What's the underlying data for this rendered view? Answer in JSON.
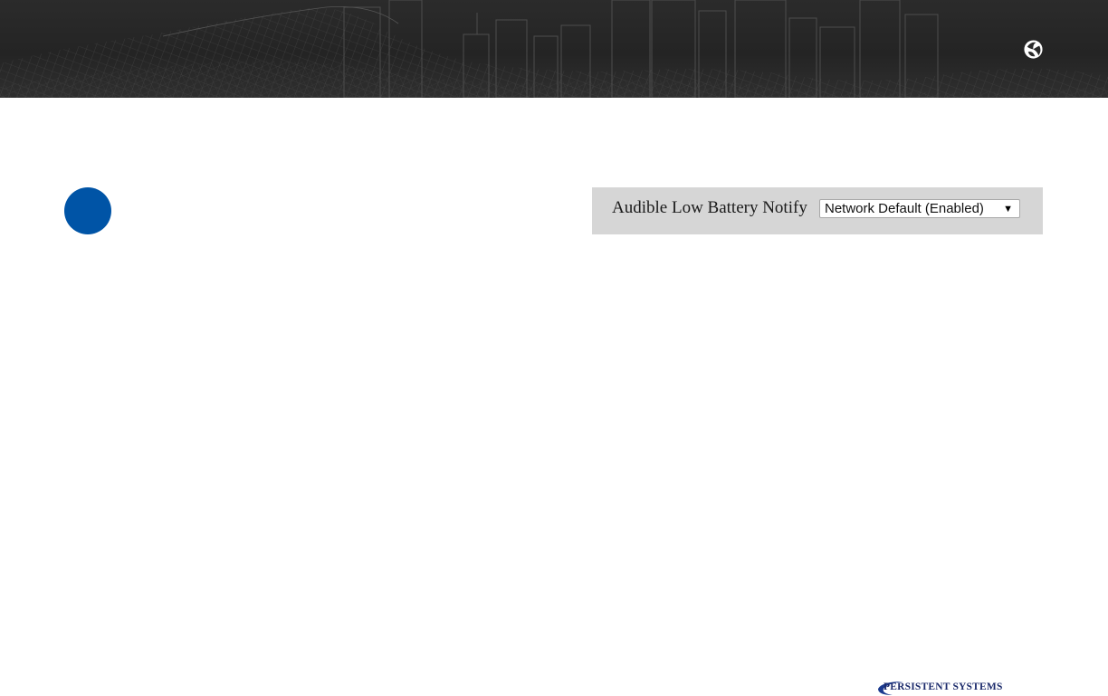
{
  "banner": {
    "brand_icon": "persistent-systems-globe-icon",
    "background_color": "#2a2a2a"
  },
  "step_marker": {
    "color": "#0054a6"
  },
  "setting": {
    "label": "Audible Low Battery Notify",
    "selected_value": "Network Default (Enabled)",
    "arrow_glyph": "▼",
    "panel_color": "#d6d6d6"
  },
  "footer": {
    "logo_text": "PERSISTENT SYSTEMS",
    "logo_color": "#1b2a6b"
  }
}
